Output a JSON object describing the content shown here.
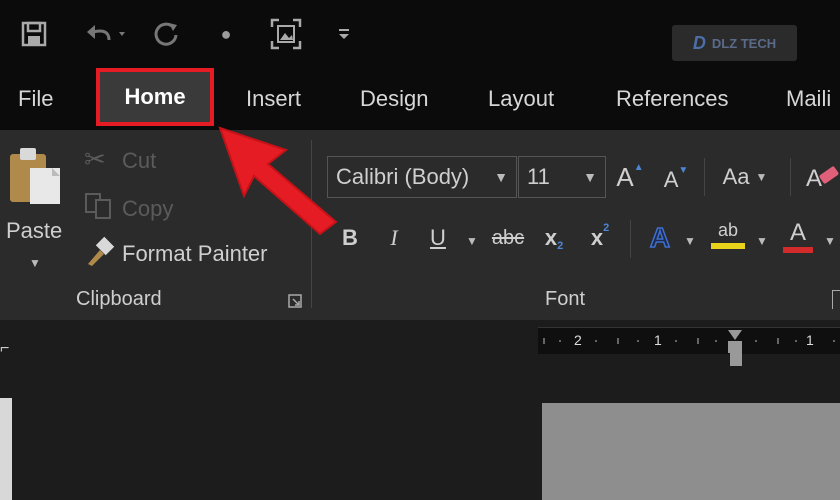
{
  "qat": {
    "icons": [
      "save-icon",
      "undo-icon",
      "redo-icon",
      "dot-icon",
      "screenshot-icon",
      "customize-icon"
    ]
  },
  "logo": {
    "text": "DLZ TECH"
  },
  "tabs": [
    {
      "label": "File"
    },
    {
      "label": "Home",
      "selected": true
    },
    {
      "label": "Insert"
    },
    {
      "label": "Design"
    },
    {
      "label": "Layout"
    },
    {
      "label": "References"
    },
    {
      "label": "Maili"
    }
  ],
  "clipboard": {
    "paste_label": "Paste",
    "cut_label": "Cut",
    "copy_label": "Copy",
    "format_painter_label": "Format Painter",
    "group_label": "Clipboard"
  },
  "font": {
    "font_name": "Calibri (Body)",
    "font_size": "11",
    "grow_label": "A",
    "shrink_label": "A",
    "case_label": "Aa",
    "bold_label": "B",
    "italic_label": "I",
    "underline_label": "U",
    "strike_label": "abc",
    "sub_label": "x",
    "sub_mark": "2",
    "sup_label": "x",
    "sup_mark": "2",
    "effects_label": "A",
    "highlight_label": "ab",
    "color_label": "A",
    "group_label": "Font"
  },
  "colors": {
    "accent_red": "#e51c23",
    "highlight_yellow": "#e8d21a",
    "font_color_red": "#d22b2b",
    "effects_blue": "#3f6fd1"
  },
  "ruler": {
    "numbers": [
      "2",
      "1",
      "1"
    ]
  }
}
